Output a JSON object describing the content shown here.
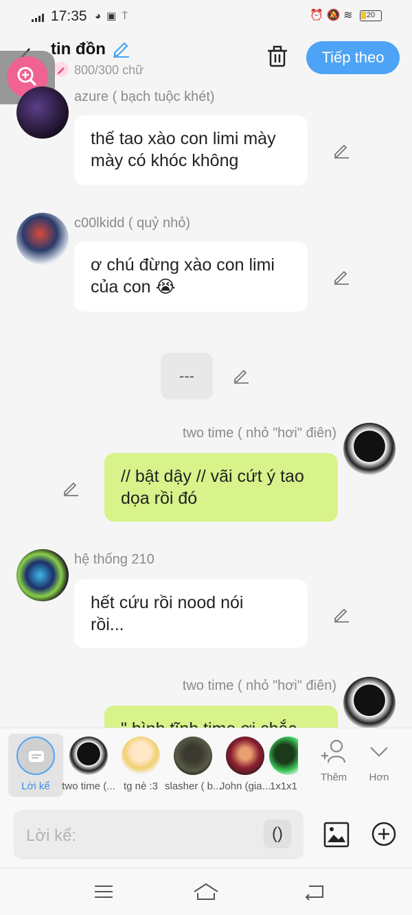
{
  "status": {
    "time": "17:35",
    "battery": "20"
  },
  "header": {
    "title": "tin đồn",
    "word_count": "800/300 chữ",
    "next_label": "Tiếp theo"
  },
  "messages": [
    {
      "name": "azure ( bạch tuộc khét)",
      "text": "thế tao xào con limi mày\nmày có khóc không"
    },
    {
      "name": "c00lkidd ( quỷ nhỏ)",
      "text": "ơ chú đừng xào con limi\ncủa con 😭"
    },
    {
      "separator": "---"
    },
    {
      "name": "two time ( nhỏ \"hơi\" điên)",
      "text": "// bật dậy // vãi cứt ý tao\ndọa rồi đó"
    },
    {
      "name": "hệ thống 210",
      "text": "hết cứu rồi nood nói\nrồi..."
    },
    {
      "name": "two time ( nhỏ \"hơi\" điên)",
      "text": "\" bình tĩnh time ơi chắc"
    }
  ],
  "characters": [
    {
      "name": "Lời kể",
      "icon": "narrator-icon"
    },
    {
      "name": "two time (...",
      "icon": "avatar"
    },
    {
      "name": "tg nè :3",
      "icon": "avatar"
    },
    {
      "name": "slasher ( b...",
      "icon": "avatar"
    },
    {
      "name": "John (gia...",
      "icon": "avatar"
    },
    {
      "name": "1x1x1",
      "icon": "avatar"
    }
  ],
  "actions": {
    "more_label": "Thêm",
    "expand_label": "Hơn"
  },
  "input": {
    "placeholder": "Lời kể:",
    "paren": "()"
  },
  "colors": {
    "accent": "#4da3f5",
    "my_bubble": "#d8f38a",
    "zoom": "#f06292"
  }
}
